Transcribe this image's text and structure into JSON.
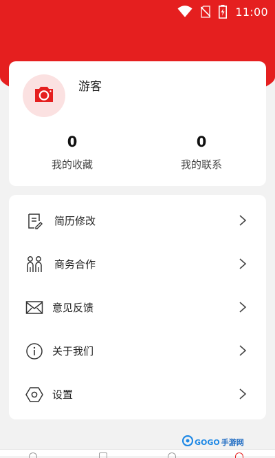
{
  "status_bar": {
    "time": "11:00"
  },
  "profile": {
    "username": "游客",
    "favorites": {
      "value": "0",
      "label": "我的收藏"
    },
    "contacts": {
      "value": "0",
      "label": "我的联系"
    }
  },
  "menu": {
    "items": [
      {
        "label": "简历修改",
        "icon": "resume-edit-icon"
      },
      {
        "label": "商务合作",
        "icon": "partners-icon"
      },
      {
        "label": "意见反馈",
        "icon": "mail-icon"
      },
      {
        "label": "关于我们",
        "icon": "info-icon"
      },
      {
        "label": "设置",
        "icon": "settings-hexagon-icon"
      }
    ]
  },
  "watermark": {
    "brand": "GOGO",
    "suffix": "手游网"
  },
  "colors": {
    "accent": "#e51f1f",
    "background": "#f2f2f2",
    "avatar_bg": "#fbe1e1"
  }
}
